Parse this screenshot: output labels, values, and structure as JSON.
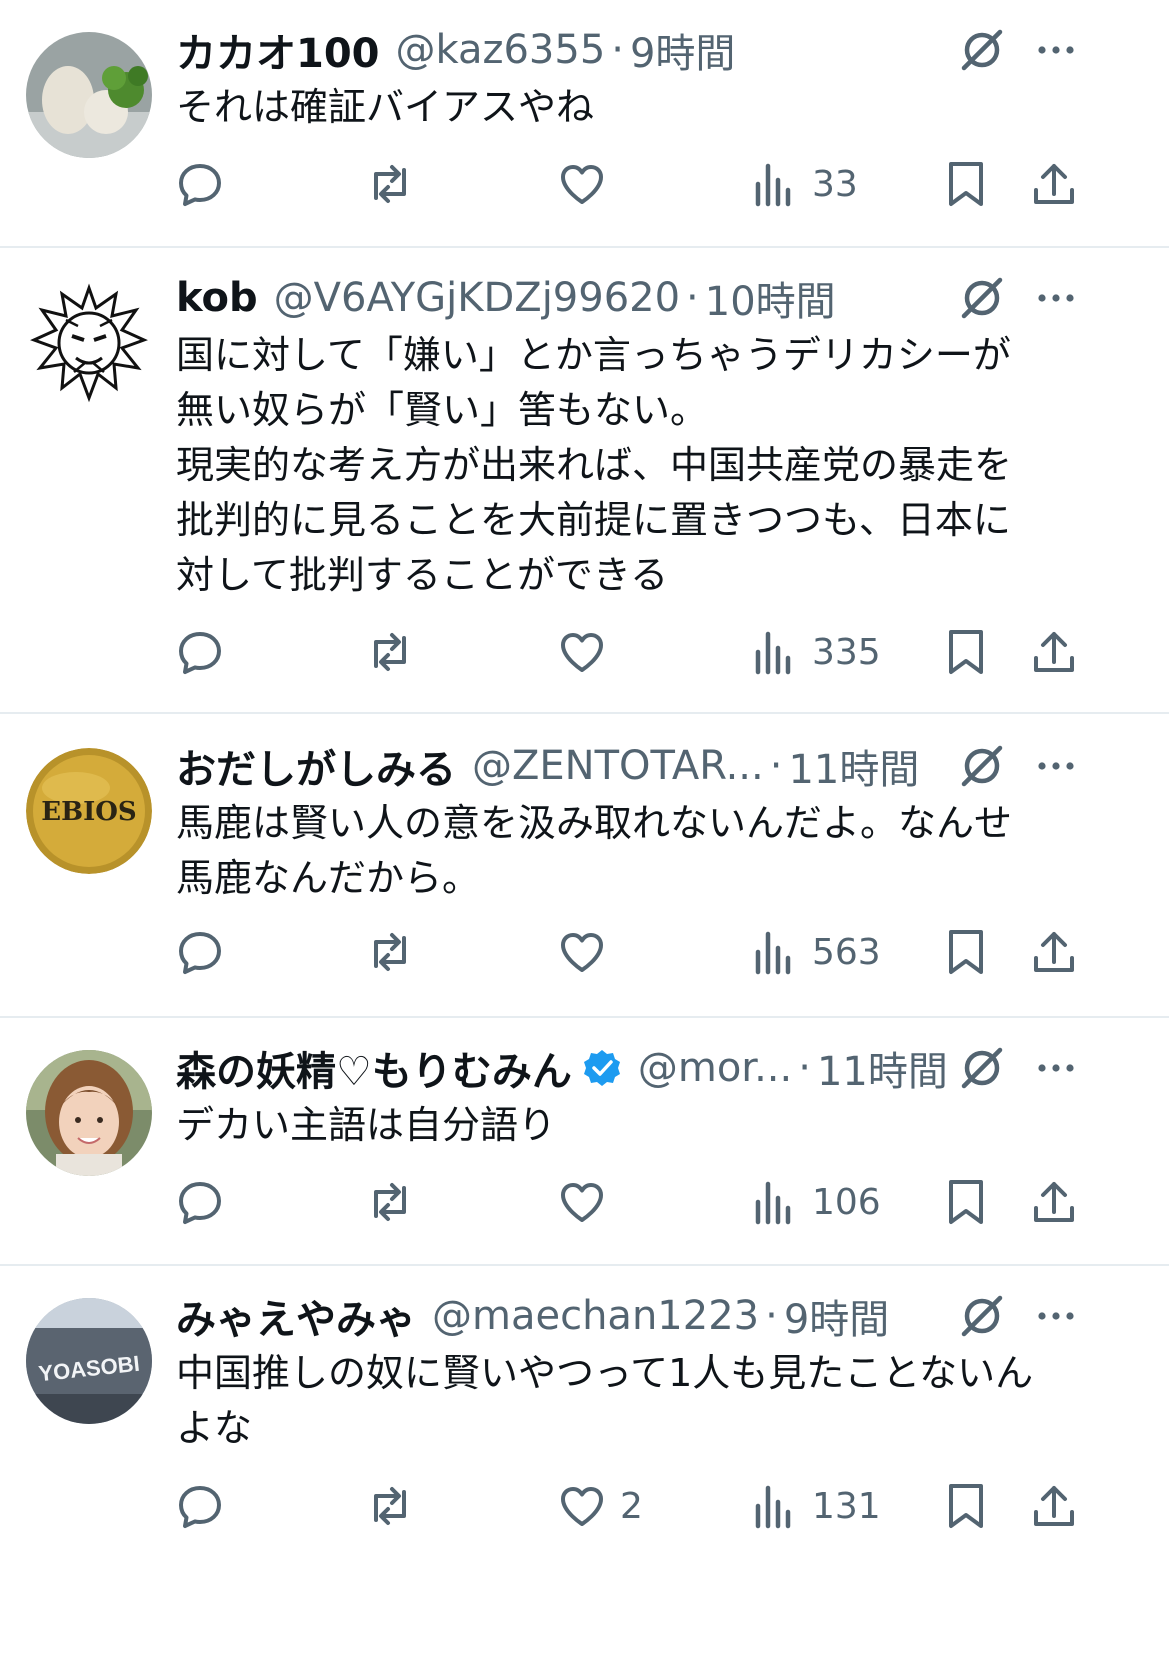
{
  "accent": "#1d9bf0",
  "text_color": "#0f1419",
  "muted_color": "#536471",
  "icons": {
    "reply": "reply-icon",
    "repost": "repost-icon",
    "like": "like-icon",
    "views": "views-icon",
    "bookmark": "bookmark-icon",
    "share": "share-icon",
    "grok": "grok-icon",
    "more": "more-icon",
    "verified": "verified-badge-icon"
  },
  "tweets": [
    {
      "name": "カカオ100",
      "handle": "@kaz6355",
      "sep": "·",
      "time": "9時間",
      "text": "それは確証バイアスやね",
      "likes": "",
      "views": "33",
      "avatar": "food"
    },
    {
      "name": "kob",
      "handle": "@V6AYGjKDZj99620",
      "sep": "·",
      "time": "10時間",
      "text": "国に対して「嫌い」とか言っちゃうデリカシーが\n無い奴らが「賢い」筈もない。\n現実的な考え方が出来れば、中国共産党の暴走を\n批判的に見ることを大前提に置きつつも、日本に\n対して批判することができる",
      "likes": "",
      "views": "335",
      "avatar": "manga"
    },
    {
      "name": "おだしがしみる",
      "handle": "@ZENTOTAR...",
      "sep": "·",
      "time": "11時間",
      "text": "馬鹿は賢い人の意を汲み取れないんだよ。なんせ\n馬鹿なんだから。",
      "likes": "",
      "views": "563",
      "avatar": "ebios",
      "avatar_text": "EBIOS"
    },
    {
      "name": "森の妖精♡もりむみん",
      "handle": "@mor...",
      "sep": "·",
      "time": "11時間",
      "text": "デカい主語は自分語り",
      "likes": "",
      "views": "106",
      "avatar": "person",
      "verified": true
    },
    {
      "name": "みゃえやみゃ",
      "handle": "@maechan1223",
      "sep": "·",
      "time": "9時間",
      "text": "中国推しの奴に賢いやつって1人も見たことないん\nよな",
      "likes": "2",
      "views": "131",
      "avatar": "yoasobi",
      "avatar_text": "YOASOBI"
    }
  ]
}
